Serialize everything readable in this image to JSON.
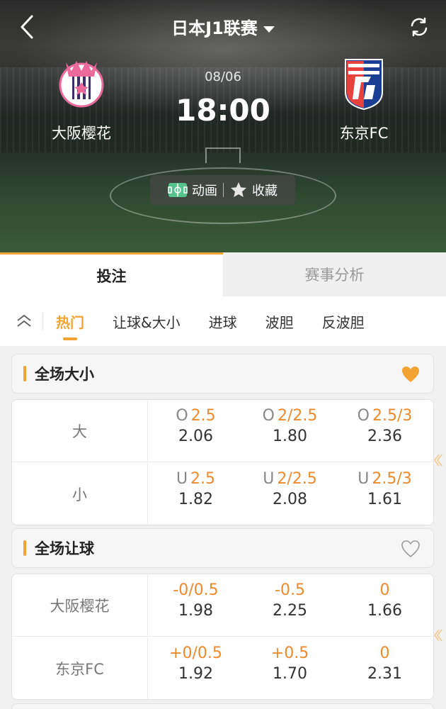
{
  "header": {
    "league_title": "日本J1联赛",
    "icons": {
      "back": "back-arrow-icon",
      "refresh": "refresh-icon",
      "caret": "caret-down-icon"
    }
  },
  "match": {
    "date": "08/06",
    "time": "18:00",
    "home": {
      "name": "大阪樱花",
      "logo": "cerezo-osaka-crest"
    },
    "away": {
      "name": "东京FC",
      "logo": "fc-tokyo-crest"
    }
  },
  "actions": {
    "animation_label": "动画",
    "favorite_label": "收藏"
  },
  "main_tabs": [
    {
      "label": "投注"
    },
    {
      "label": "赛事分析"
    }
  ],
  "sub_tabs": [
    {
      "label": "热门"
    },
    {
      "label": "让球&大小"
    },
    {
      "label": "进球"
    },
    {
      "label": "波胆"
    },
    {
      "label": "反波胆"
    }
  ],
  "sections": [
    {
      "title": "全场大小",
      "favorited": true,
      "rows": [
        {
          "label": "大",
          "cells": [
            {
              "prefix": "O",
              "line": "2.5",
              "odds": "2.06"
            },
            {
              "prefix": "O",
              "line": "2/2.5",
              "odds": "1.80"
            },
            {
              "prefix": "O",
              "line": "2.5/3",
              "odds": "2.36"
            }
          ]
        },
        {
          "label": "小",
          "cells": [
            {
              "prefix": "U",
              "line": "2.5",
              "odds": "1.82"
            },
            {
              "prefix": "U",
              "line": "2/2.5",
              "odds": "2.08"
            },
            {
              "prefix": "U",
              "line": "2.5/3",
              "odds": "1.61"
            }
          ]
        }
      ]
    },
    {
      "title": "全场让球",
      "favorited": false,
      "rows": [
        {
          "label": "大阪樱花",
          "cells": [
            {
              "prefix": "",
              "line": "-0/0.5",
              "odds": "1.98"
            },
            {
              "prefix": "",
              "line": "-0.5",
              "odds": "2.25"
            },
            {
              "prefix": "",
              "line": "0",
              "odds": "1.66"
            }
          ]
        },
        {
          "label": "东京FC",
          "cells": [
            {
              "prefix": "",
              "line": "+0/0.5",
              "odds": "1.92"
            },
            {
              "prefix": "",
              "line": "+0.5",
              "odds": "1.70"
            },
            {
              "prefix": "",
              "line": "0",
              "odds": "2.31"
            }
          ]
        }
      ]
    }
  ],
  "colors": {
    "accent": "#f2a332",
    "handicap": "#ee8a2c"
  }
}
